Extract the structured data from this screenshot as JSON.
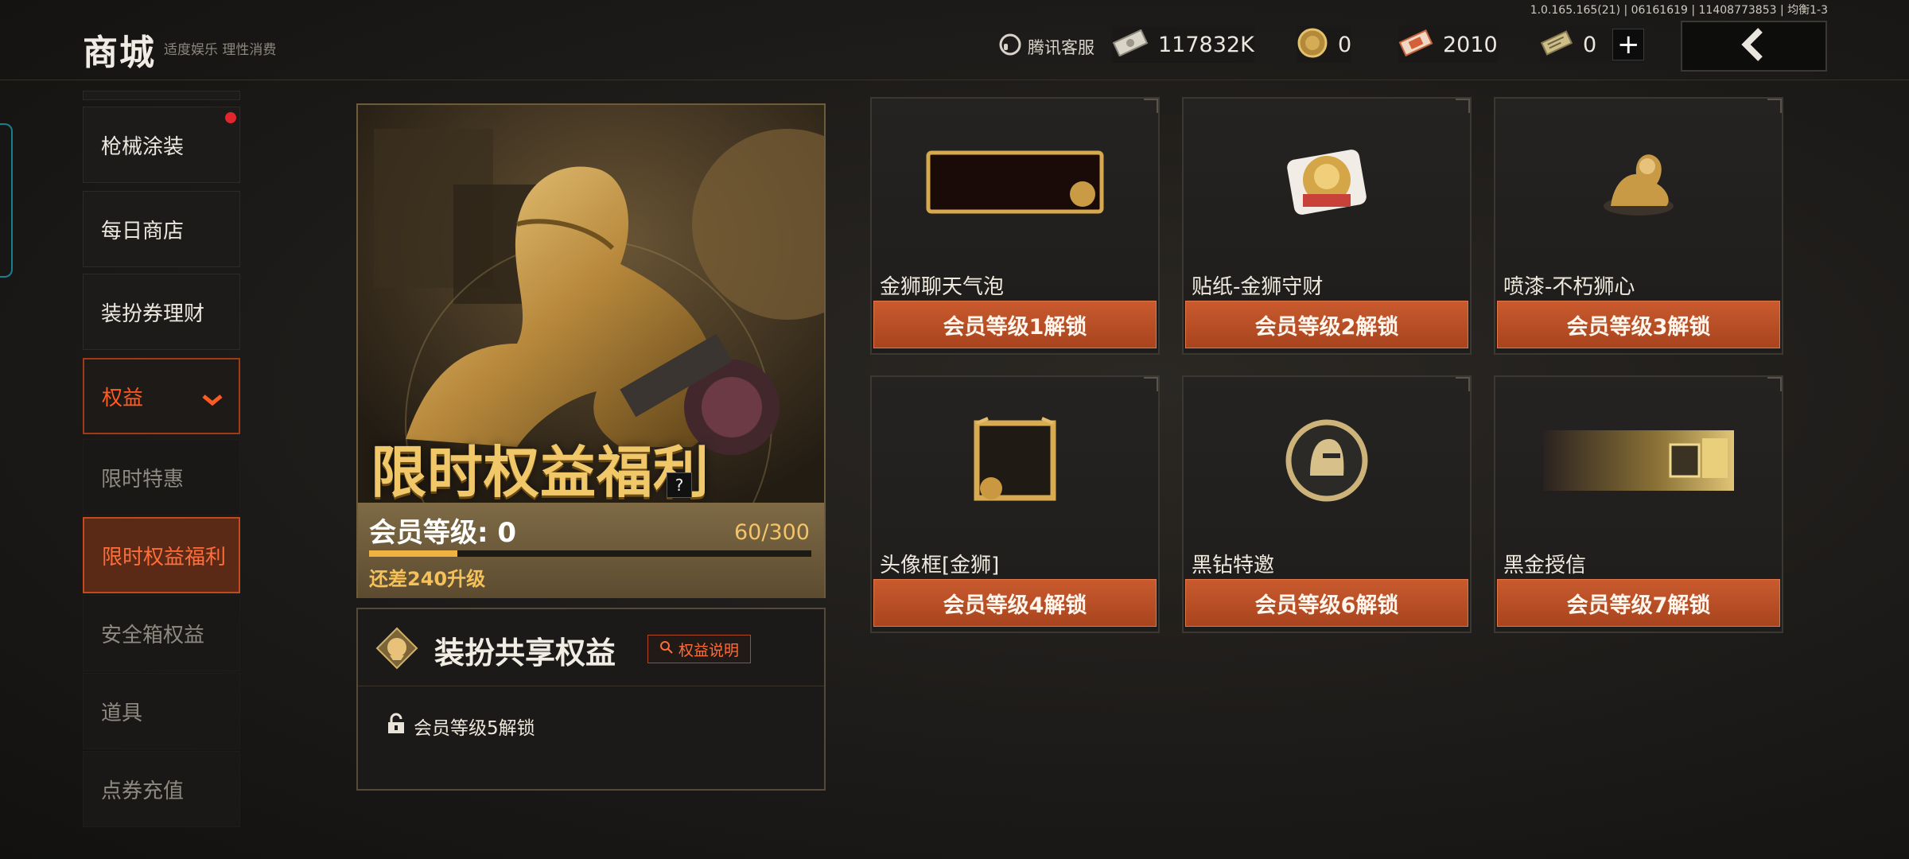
{
  "header": {
    "title": "商城",
    "subtitle": "适度娱乐 理性消费",
    "version": "1.0.165.165(21) | 06161619 | 11408773853 | 均衡1-3",
    "support_label": "腾讯客服",
    "currencies": [
      {
        "icon": "banknote-icon",
        "value": "117832K"
      },
      {
        "icon": "gold-coin-icon",
        "value": "0"
      },
      {
        "icon": "voucher-ticket-icon",
        "value": "2010"
      },
      {
        "icon": "cash-ticket-icon",
        "value": "0"
      }
    ],
    "add_label": "+"
  },
  "sidebar": {
    "items": [
      {
        "label": "枪械涂装",
        "badge": true
      },
      {
        "label": "每日商店"
      },
      {
        "label": "装扮券理财"
      },
      {
        "label": "权益",
        "expanded": true
      },
      {
        "label": "限时特惠"
      },
      {
        "label": "限时权益福利",
        "active": true
      },
      {
        "label": "安全箱权益"
      },
      {
        "label": "道具"
      },
      {
        "label": "点券充值"
      }
    ]
  },
  "hero": {
    "title": "限时权益福利",
    "help": "?",
    "level_label": "会员等级: 0",
    "progress_text": "60/300",
    "progress": 0.2,
    "need_text": "还差240升级"
  },
  "share": {
    "title": "装扮共享权益",
    "info_button": "权益说明",
    "lock_text": "会员等级5解锁"
  },
  "rewards": [
    {
      "name": "金狮聊天气泡",
      "unlock": "会员等级1解锁",
      "icon": "chat-bubble-icon"
    },
    {
      "name": "贴纸-金狮守财",
      "unlock": "会员等级2解锁",
      "icon": "lion-sticker-icon"
    },
    {
      "name": "喷漆-不朽狮心",
      "unlock": "会员等级3解锁",
      "icon": "lion-spray-icon"
    },
    {
      "name": "头像框[金狮]",
      "unlock": "会员等级4解锁",
      "icon": "avatar-frame-icon"
    },
    {
      "name": "黑钻特邀",
      "unlock": "会员等级6解锁",
      "icon": "knight-badge-icon"
    },
    {
      "name": "黑金授信",
      "unlock": "会员等级7解锁",
      "icon": "gold-banner-icon"
    }
  ],
  "colors": {
    "accent": "#c95a2e",
    "gold": "#f1c869",
    "active_text": "#ff6d3a"
  }
}
